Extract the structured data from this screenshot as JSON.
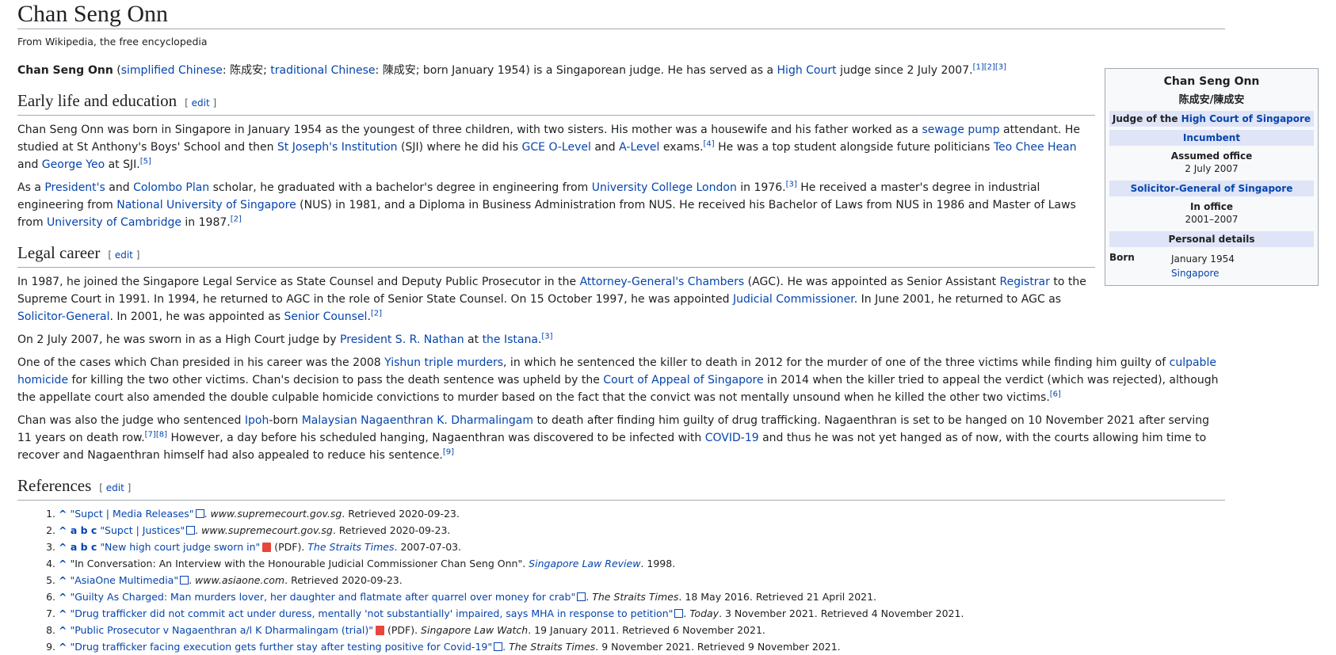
{
  "title": "Chan Seng Onn",
  "tagline": "From Wikipedia, the free encyclopedia",
  "lead": {
    "name": "Chan Seng Onn",
    "simplified_label": "simplified Chinese",
    "simplified": "陈成安",
    "traditional_label": "traditional Chinese",
    "traditional": "陳成安",
    "born_text": "; born January 1954) is a Singaporean judge. He has served as a ",
    "high_court": "High Court",
    "tail": " judge since 2 July 2007.",
    "refs": "[1][2][3]"
  },
  "sections": {
    "early": {
      "heading": "Early life and education",
      "edit": "edit",
      "p1": {
        "a": "Chan Seng Onn was born in Singapore in January 1954 as the youngest of three children, with two sisters. His mother was a housewife and his father worked as a ",
        "l1": "sewage pump",
        "b": " attendant. He studied at St Anthony's Boys' School and then ",
        "l2": "St Joseph's Institution",
        "c": " (SJI) where he did his ",
        "l3": "GCE O-Level",
        "d": " and ",
        "l4": "A-Level",
        "e": " exams.",
        "r1": "[4]",
        "f": " He was a top student alongside future politicians ",
        "l5": "Teo Chee Hean",
        "g": " and ",
        "l6": "George Yeo",
        "h": " at SJI.",
        "r2": "[5]"
      },
      "p2": {
        "a": "As a ",
        "l1": "President's",
        "b": " and ",
        "l2": "Colombo Plan",
        "c": " scholar, he graduated with a bachelor's degree in engineering from ",
        "l3": "University College London",
        "d": " in 1976.",
        "r1": "[3]",
        "e": " He received a master's degree in industrial engineering from ",
        "l4": "National University of Singapore",
        "f": " (NUS) in 1981, and a Diploma in Business Administration from NUS. He received his Bachelor of Laws from NUS in 1986 and Master of Laws from ",
        "l5": "University of Cambridge",
        "g": " in 1987.",
        "r2": "[2]"
      }
    },
    "legal": {
      "heading": "Legal career",
      "edit": "edit",
      "p1": {
        "a": "In 1987, he joined the Singapore Legal Service as State Counsel and Deputy Public Prosecutor in the ",
        "l1": "Attorney-General's Chambers",
        "b": " (AGC). He was appointed as Senior Assistant ",
        "l2": "Registrar",
        "c": " to the Supreme Court in 1991. In 1994, he returned to AGC in the role of Senior State Counsel. On 15 October 1997, he was appointed ",
        "l3": "Judicial Commissioner",
        "d": ". In June 2001, he returned to AGC as ",
        "l4": "Solicitor-General",
        "e": ". In 2001, he was appointed as ",
        "l5": "Senior Counsel",
        "f": ".",
        "r1": "[2]"
      },
      "p2": {
        "a": "On 2 July 2007, he was sworn in as a High Court judge by ",
        "l1": "President S. R. Nathan",
        "b": " at ",
        "l2": "the Istana",
        "c": ".",
        "r1": "[3]"
      },
      "p3": {
        "a": "One of the cases which Chan presided in his career was the 2008 ",
        "l1": "Yishun triple murders",
        "b": ", in which he sentenced the killer to death in 2012 for the murder of one of the three victims while finding him guilty of ",
        "l2": "culpable homicide",
        "c": " for killing the two other victims. Chan's decision to pass the death sentence was upheld by the ",
        "l3": "Court of Appeal of Singapore",
        "d": " in 2014 when the killer tried to appeal the verdict (which was rejected), although the appellate court also amended the double culpable homicide convictions to murder based on the fact that the convict was not mentally unsound when he killed the other two victims.",
        "r1": "[6]"
      },
      "p4": {
        "a": "Chan was also the judge who sentenced ",
        "l1": "Ipoh",
        "b": "-born ",
        "l2": "Malaysian Nagaenthran K. Dharmalingam",
        "c": " to death after finding him guilty of drug trafficking. Nagaenthran is set to be hanged on 10 November 2021 after serving 11 years on death row.",
        "r1": "[7][8]",
        "d": " However, a day before his scheduled hanging, Nagaenthran was discovered to be infected with ",
        "l3": "COVID-19",
        "e": " and thus he was not yet hanged as of now, with the courts allowing him time to recover and Nagaenthran himself had also appealed to reduce his sentence.",
        "r2": "[9]"
      }
    },
    "refs": {
      "heading": "References",
      "edit": "edit",
      "items": [
        {
          "caret": "^",
          "title": "\"Supct | Media Releases\"",
          "src": "www.supremecourt.gov.sg",
          "rest": ". Retrieved 2020-09-23."
        },
        {
          "caret": "^ a b c",
          "title": "\"Supct | Justices\"",
          "src": "www.supremecourt.gov.sg",
          "rest": ". Retrieved 2020-09-23."
        },
        {
          "caret": "^ a b c",
          "title": "\"New high court judge sworn in\"",
          "mid": " (PDF). ",
          "src": "The Straits Times",
          "rest": ". 2007-07-03."
        },
        {
          "caret": "^",
          "plain": "\"In Conversation: An Interview with the Honourable Judicial Commissioner Chan Seng Onn\". ",
          "src": "Singapore Law Review",
          "rest": ". 1998."
        },
        {
          "caret": "^",
          "title": "\"AsiaOne Multimedia\"",
          "src": "www.asiaone.com",
          "rest": ". Retrieved 2020-09-23."
        },
        {
          "caret": "^",
          "title": "\"Guilty As Charged: Man murders lover, her daughter and flatmate after quarrel over money for crab\"",
          "src": "The Straits Times",
          "rest": ". 18 May 2016. Retrieved 21 April 2021."
        },
        {
          "caret": "^",
          "title": "\"Drug trafficker did not commit act under duress, mentally 'not substantially' impaired, says MHA in response to petition\"",
          "src": "Today",
          "rest": ". 3 November 2021. Retrieved 4 November 2021."
        },
        {
          "caret": "^",
          "title": "\"Public Prosecutor v Nagaenthran a/l K Dharmalingam (trial)\"",
          "mid": " (PDF). ",
          "src": "Singapore Law Watch",
          "rest": ". 19 January 2011. Retrieved 6 November 2021."
        },
        {
          "caret": "^",
          "title": "\"Drug trafficker facing execution gets further stay after testing positive for Covid-19\"",
          "src": "The Straits Times",
          "rest": ". 9 November 2021. Retrieved 9 November 2021."
        }
      ]
    }
  },
  "infobox": {
    "title": "Chan Seng Onn",
    "subtitle": "陈成安/陳成安",
    "office1_prefix": "Judge of the ",
    "office1_link": "High Court of Singapore",
    "incumbent": "Incumbent",
    "assumed_label": "Assumed office",
    "assumed_val": "2 July 2007",
    "office2": "Solicitor-General of Singapore",
    "inoffice_label": "In office",
    "inoffice_val": "2001–2007",
    "personal": "Personal details",
    "born_label": "Born",
    "born_date": "January 1954",
    "born_place": "Singapore"
  }
}
